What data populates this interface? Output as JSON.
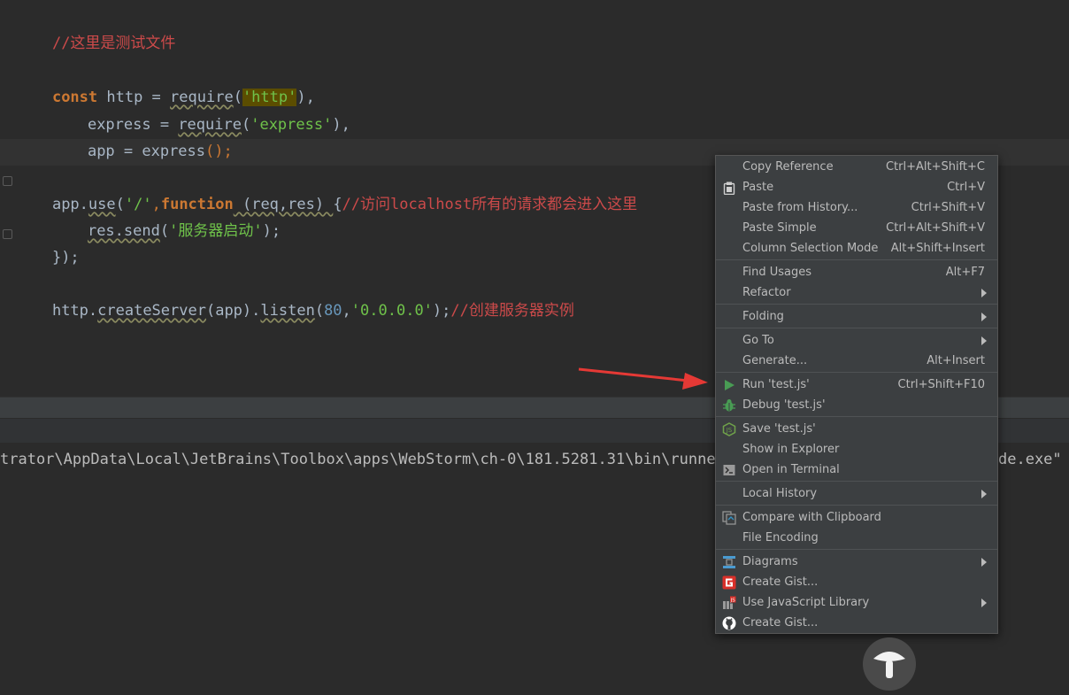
{
  "editor": {
    "lines": {
      "comment_top": "//这里是测试文件",
      "l3": {
        "kw": "const",
        "id": " http = ",
        "fn": "require",
        "open": "(",
        "str": "'http'",
        "close": "),"
      },
      "l4": {
        "id": "express = ",
        "fn": "require",
        "open": "(",
        "str": "'express'",
        "close": "),"
      },
      "l5": {
        "id": "app = express",
        "paren": "();"
      },
      "l7": {
        "obj": "app.",
        "fn": "use",
        "open": "(",
        "str": "'/'",
        "comma": ",",
        "kw": "function",
        "params": " (req,res) ",
        "brace": "{",
        "comment": "//访问localhost所有的请求都会进入这里"
      },
      "l8": {
        "obj": "res.send",
        "open": "(",
        "str": "'服务器启动'",
        "close": ");"
      },
      "l9": {
        "text": "});"
      },
      "l11": {
        "obj": "http.",
        "fn1": "createServer",
        "args1": "(app).",
        "fn2": "listen",
        "open": "(",
        "num": "80",
        "comma": ",",
        "str": "'0.0.0.0'",
        "close": ");",
        "comment": "//创建服务器实例"
      }
    }
  },
  "console": {
    "line": "trator\\AppData\\Local\\JetBrains\\Toolbox\\apps\\WebStorm\\ch-0\\181.5281.31\\bin\\runnerw",
    "tail": "de.exe\" "
  },
  "menu": {
    "items": [
      {
        "label": "Copy Reference",
        "shortcut": "Ctrl+Alt+Shift+C",
        "icon": ""
      },
      {
        "label": "Paste",
        "shortcut": "Ctrl+V",
        "icon": "clipboard-icon"
      },
      {
        "label": "Paste from History...",
        "shortcut": "Ctrl+Shift+V",
        "icon": ""
      },
      {
        "label": "Paste Simple",
        "shortcut": "Ctrl+Alt+Shift+V",
        "icon": ""
      },
      {
        "label": "Column Selection Mode",
        "shortcut": "Alt+Shift+Insert",
        "icon": ""
      },
      {
        "label": "Find Usages",
        "shortcut": "Alt+F7",
        "icon": ""
      },
      {
        "label": "Refactor",
        "shortcut": "",
        "icon": "",
        "submenu": true
      },
      {
        "label": "Folding",
        "shortcut": "",
        "icon": "",
        "submenu": true
      },
      {
        "label": "Go To",
        "shortcut": "",
        "icon": "",
        "submenu": true
      },
      {
        "label": "Generate...",
        "shortcut": "Alt+Insert",
        "icon": ""
      },
      {
        "label": "Run 'test.js'",
        "shortcut": "Ctrl+Shift+F10",
        "icon": "run-icon"
      },
      {
        "label": "Debug 'test.js'",
        "shortcut": "",
        "icon": "debug-icon"
      },
      {
        "label": "Save 'test.js'",
        "shortcut": "",
        "icon": "nodejs-icon"
      },
      {
        "label": "Show in Explorer",
        "shortcut": "",
        "icon": ""
      },
      {
        "label": "Open in Terminal",
        "shortcut": "",
        "icon": "terminal-icon"
      },
      {
        "label": "Local History",
        "shortcut": "",
        "icon": "",
        "submenu": true
      },
      {
        "label": "Compare with Clipboard",
        "shortcut": "",
        "icon": "compare-icon"
      },
      {
        "label": "File Encoding",
        "shortcut": "",
        "icon": ""
      },
      {
        "label": "Diagrams",
        "shortcut": "",
        "icon": "diagram-icon",
        "submenu": true
      },
      {
        "label": "Create Gist...",
        "shortcut": "",
        "icon": "gist-red-icon"
      },
      {
        "label": "Use JavaScript Library",
        "shortcut": "",
        "icon": "js-library-icon",
        "submenu": true
      },
      {
        "label": "Create Gist...",
        "shortcut": "",
        "icon": "github-icon"
      }
    ]
  },
  "colors": {
    "accent_run": "#499c54",
    "arrow": "#e53935"
  }
}
